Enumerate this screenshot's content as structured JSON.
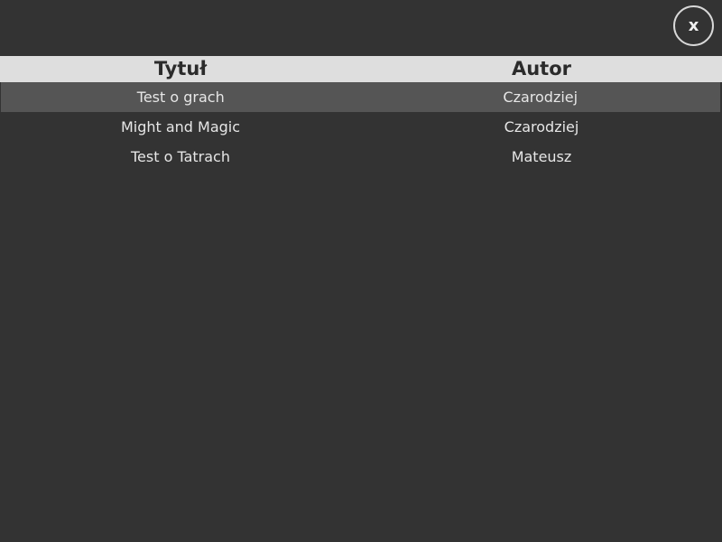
{
  "close_button": {
    "label": "x"
  },
  "table": {
    "columns": [
      "Tytuł",
      "Autor"
    ],
    "rows": [
      {
        "title": "Test o grach",
        "author": "Czarodziej",
        "selected": true
      },
      {
        "title": "Might and Magic",
        "author": "Czarodziej",
        "selected": false
      },
      {
        "title": "Test o Tatrach",
        "author": "Mateusz",
        "selected": false
      }
    ]
  },
  "colors": {
    "background": "#333333",
    "header_background": "#dedede",
    "selected_row": "#555555",
    "text": "#e6e6e6"
  }
}
